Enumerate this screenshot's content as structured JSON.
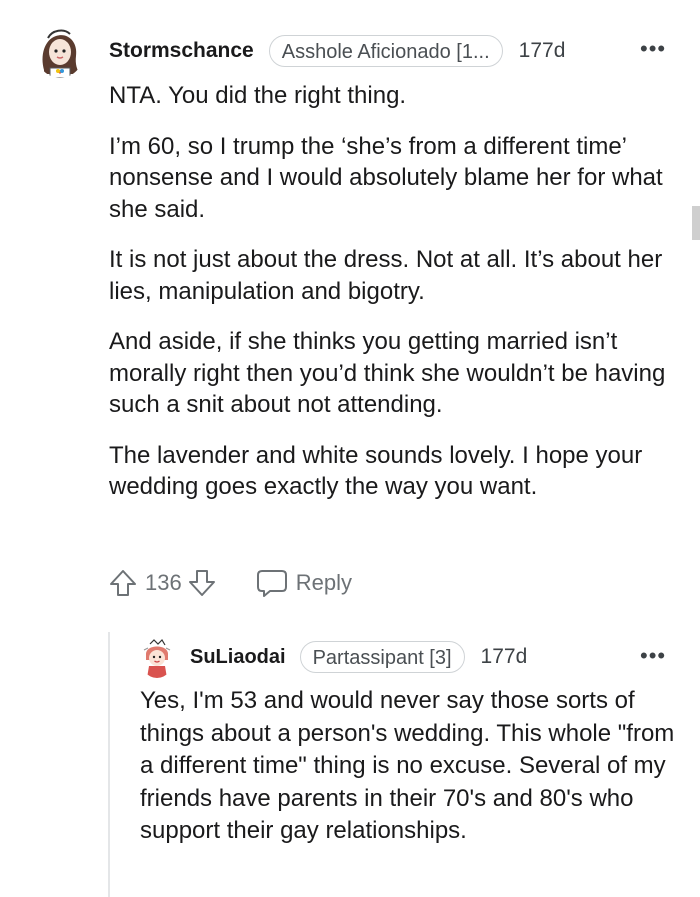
{
  "comment": {
    "username": "Stormschance",
    "flair": "Asshole Aficionado [1...",
    "time": "177d",
    "more_label": "•••",
    "paragraphs": [
      "NTA. You did the right thing.",
      "I’m 60, so I trump the ‘she’s from a different time’ nonsense and I would absolutely blame her for what she said.",
      "It is not just about the dress. Not at all. It’s about her lies, manipulation and bigotry.",
      "And aside, if she thinks you getting married isn’t morally right then you’d think she wouldn’t be having such a snit about not attending.",
      "The lavender and white sounds lovely. I hope your wedding goes exactly the way you want."
    ],
    "score": "136",
    "reply_label": "Reply",
    "icons": {
      "avatar": "avatar-icon",
      "upvote": "upvote-arrow-icon",
      "downvote": "downvote-arrow-icon",
      "reply": "reply-bubble-icon",
      "more": "more-options-icon"
    }
  },
  "reply_comment": {
    "username": "SuLiaodai",
    "flair": "Partassipant [3]",
    "time": "177d",
    "more_label": "•••",
    "text": "Yes, I'm 53 and would never say those sorts of things about a person's wedding. This whole \"from a different time\" thing is no excuse. Several of my friends have parents in their 70's and 80's who support their gay relationships."
  },
  "colors": {
    "text": "#1a1a1b",
    "meta_gray": "#3d4246",
    "action_gray": "#6d7276",
    "flair_border": "#cfd3d6",
    "thread_line": "#e4e6e8"
  }
}
